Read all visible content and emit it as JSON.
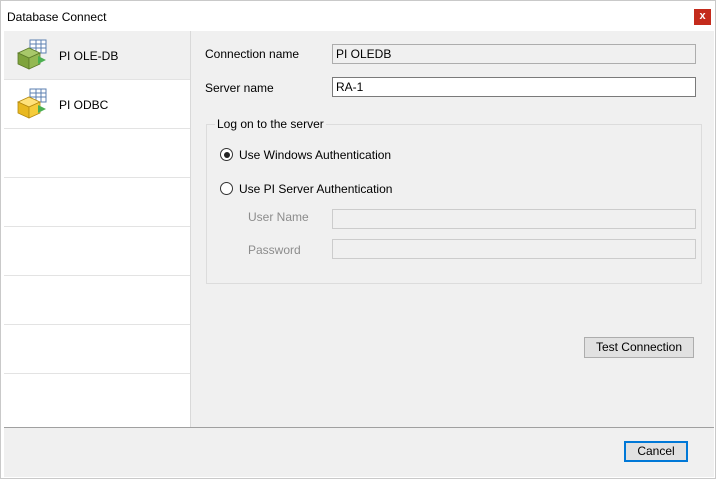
{
  "window": {
    "title": "Database Connect",
    "close_label": "x"
  },
  "sidebar": {
    "items": [
      {
        "label": "PI OLE-DB",
        "icon": "database-green-icon"
      },
      {
        "label": "PI ODBC",
        "icon": "database-yellow-icon"
      },
      {
        "label": ""
      },
      {
        "label": ""
      },
      {
        "label": ""
      },
      {
        "label": ""
      },
      {
        "label": ""
      }
    ]
  },
  "form": {
    "connection_name_label": "Connection name",
    "connection_name_value": "PI OLEDB",
    "server_name_label": "Server name",
    "server_name_value": "RA-1",
    "logon_group_title": "Log on to the server",
    "windows_auth_label": "Use Windows Authentication",
    "pi_server_auth_label": "Use PI Server Authentication",
    "selected_auth": "windows",
    "user_name_label": "User Name",
    "user_name_value": "",
    "password_label": "Password",
    "password_value": "",
    "test_connection_label": "Test Connection"
  },
  "footer": {
    "cancel_label": "Cancel"
  }
}
